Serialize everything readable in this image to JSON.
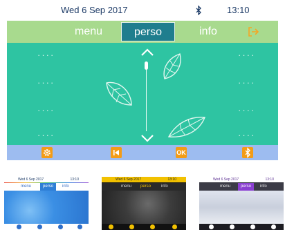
{
  "status": {
    "date": "Wed 6 Sep 2017",
    "time": "13:10",
    "bluetooth_icon": "bluetooth-icon"
  },
  "tabs": {
    "menu": "menu",
    "perso": "perso",
    "info": "info",
    "exit_icon": "exit-icon"
  },
  "content": {
    "left_keys": [
      "····",
      "····",
      "····",
      "····"
    ],
    "right_keys": [
      "····",
      "····",
      "····",
      "····"
    ]
  },
  "bottom_keys": [
    {
      "icon": "gear-icon",
      "label": ""
    },
    {
      "icon": "previous-icon",
      "label": ""
    },
    {
      "icon": "ok-icon",
      "label": "OK"
    },
    {
      "icon": "bluetooth-icon",
      "label": ""
    }
  ],
  "themes": [
    {
      "name": "blue-theme",
      "date": "Wed 6 Sep 2017",
      "time": "13:10",
      "tabs": [
        "menu",
        "perso",
        "info"
      ]
    },
    {
      "name": "dark-theme",
      "date": "Wed 6 Sep 2017",
      "time": "13:10",
      "tabs": [
        "menu",
        "perso",
        "info"
      ]
    },
    {
      "name": "purple-theme",
      "date": "Wed 6 Sep 2017",
      "time": "13:10",
      "tabs": [
        "menu",
        "perso",
        "info"
      ]
    }
  ],
  "colors": {
    "tab_bar": "#a8da8e",
    "active_tab": "#1f7e8e",
    "content": "#2ec4a2",
    "bottom_bar": "#9dbcf0",
    "key": "#f39c17",
    "status_text": "#1c3a66"
  }
}
